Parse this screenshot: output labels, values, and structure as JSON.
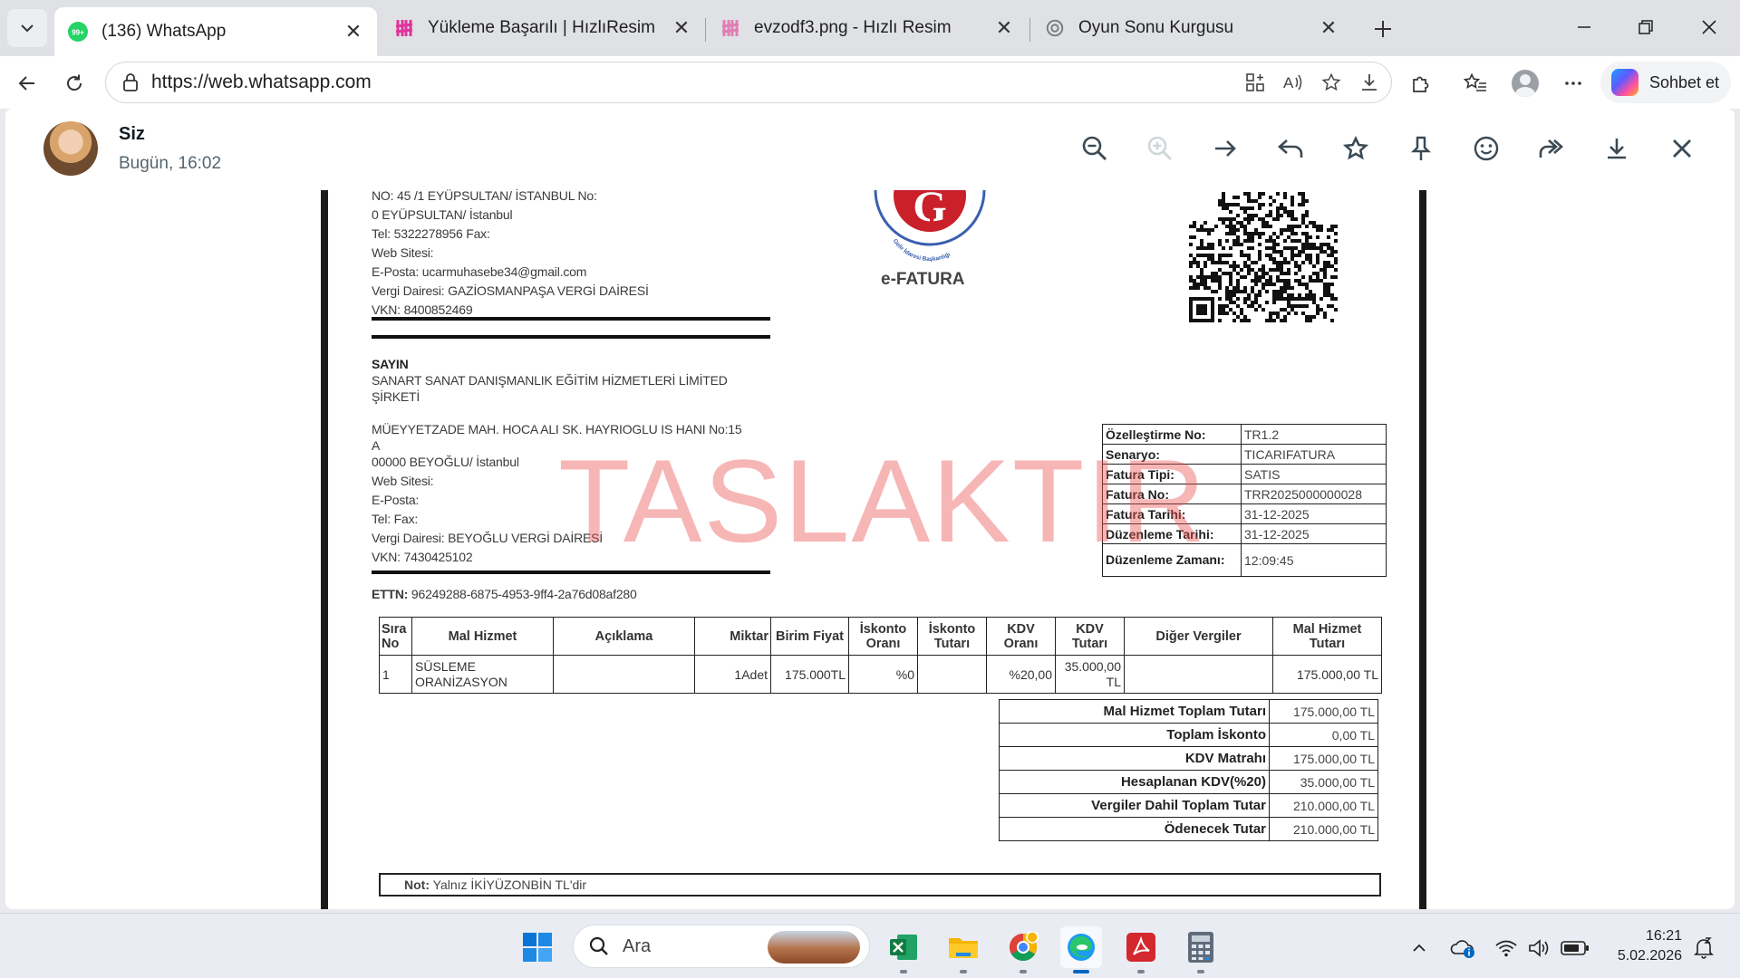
{
  "browser": {
    "tabs": [
      {
        "title": "(136) WhatsApp",
        "badge": "99+",
        "active": true
      },
      {
        "title": "Yükleme Başarılı | HızlıResim",
        "active": false
      },
      {
        "title": "evzodf3.png - Hızlı Resim",
        "active": false
      },
      {
        "title": "Oyun Sonu Kurgusu",
        "active": false
      }
    ],
    "url": "https://web.whatsapp.com",
    "copilot_label": "Sohbet et"
  },
  "viewer": {
    "sender": "Siz",
    "timestamp": "Bugün, 16:02"
  },
  "invoice": {
    "seller_lines": [
      "NO: 45 /1 EYÜPSULTAN/ İSTANBUL  No:",
      "0 EYÜPSULTAN/ İstanbul",
      "Tel: 5322278956 Fax:",
      "Web Sitesi:",
      "E-Posta: ucarmuhasebe34@gmail.com",
      "Vergi Dairesi: GAZİOSMANPAŞA VERGİ DAİRESİ",
      "VKN: 8400852469"
    ],
    "logo_text": "Gelir İdaresi Başkanlığı",
    "efatura_label": "e-FATURA",
    "buyer_heading": "SAYIN",
    "buyer_lines": [
      "SANART SANAT DANIŞMANLIK EĞİTİM HİZMETLERİ LİMİTED",
      "ŞİRKETİ",
      "",
      "MÜEYYETZADE MAH. HOCA ALI SK. HAYRIOGLU IS HANI  No:15",
      "A",
      "00000 BEYOĞLU/ İstanbul",
      "Web Sitesi:",
      "E-Posta:",
      "Tel: Fax:",
      "Vergi Dairesi: BEYOĞLU VERGİ DAİRESİ",
      "VKN: 7430425102"
    ],
    "ettn_label": "ETTN:",
    "ettn_value": "96249288-6875-4953-9ff4-2a76d08af280",
    "watermark": "TASLAKTIR",
    "details": [
      {
        "key": "Özelleştirme No:",
        "value": "TR1.2"
      },
      {
        "key": "Senaryo:",
        "value": "TICARIFATURA"
      },
      {
        "key": "Fatura Tipi:",
        "value": "SATIS"
      },
      {
        "key": "Fatura No:",
        "value": "TRR2025000000028"
      },
      {
        "key": "Fatura Tarihi:",
        "value": "31-12-2025"
      },
      {
        "key": "Düzenleme Tarihi:",
        "value": "31-12-2025"
      },
      {
        "key": "Düzenleme Zamanı:",
        "value": "12:09:45"
      }
    ],
    "item_headers": [
      "Sıra No",
      "Mal Hizmet",
      "Açıklama",
      "Miktar",
      "Birim Fiyat",
      "İskonto Oranı",
      "İskonto Tutarı",
      "KDV Oranı",
      "KDV Tutarı",
      "Diğer Vergiler",
      "Mal Hizmet Tutarı"
    ],
    "items": [
      [
        "1",
        "SÜSLEME ORANİZASYON",
        "",
        "1Adet",
        "175.000TL",
        "%0",
        "",
        "%20,00",
        "35.000,00 TL",
        "",
        "175.000,00 TL"
      ]
    ],
    "totals": [
      {
        "key": "Mal Hizmet Toplam Tutarı",
        "value": "175.000,00 TL"
      },
      {
        "key": "Toplam İskonto",
        "value": "0,00 TL"
      },
      {
        "key": "KDV Matrahı",
        "value": "175.000,00 TL"
      },
      {
        "key": "Hesaplanan KDV(%20)",
        "value": "35.000,00 TL"
      },
      {
        "key": "Vergiler Dahil Toplam Tutar",
        "value": "210.000,00 TL"
      },
      {
        "key": "Ödenecek Tutar",
        "value": "210.000,00 TL"
      }
    ],
    "note_label": "Not:",
    "note_text": "Yalnız İKİYÜZONBİN TL'dir"
  },
  "taskbar": {
    "search_placeholder": "Ara",
    "time": "16:21",
    "date": "5.02.2026"
  },
  "colors": {
    "whatsapp_green": "#25d366",
    "hizliresim_pink": "#e0349a",
    "edge_blue": "#0067c0",
    "watermark_red": "#ec5050"
  }
}
